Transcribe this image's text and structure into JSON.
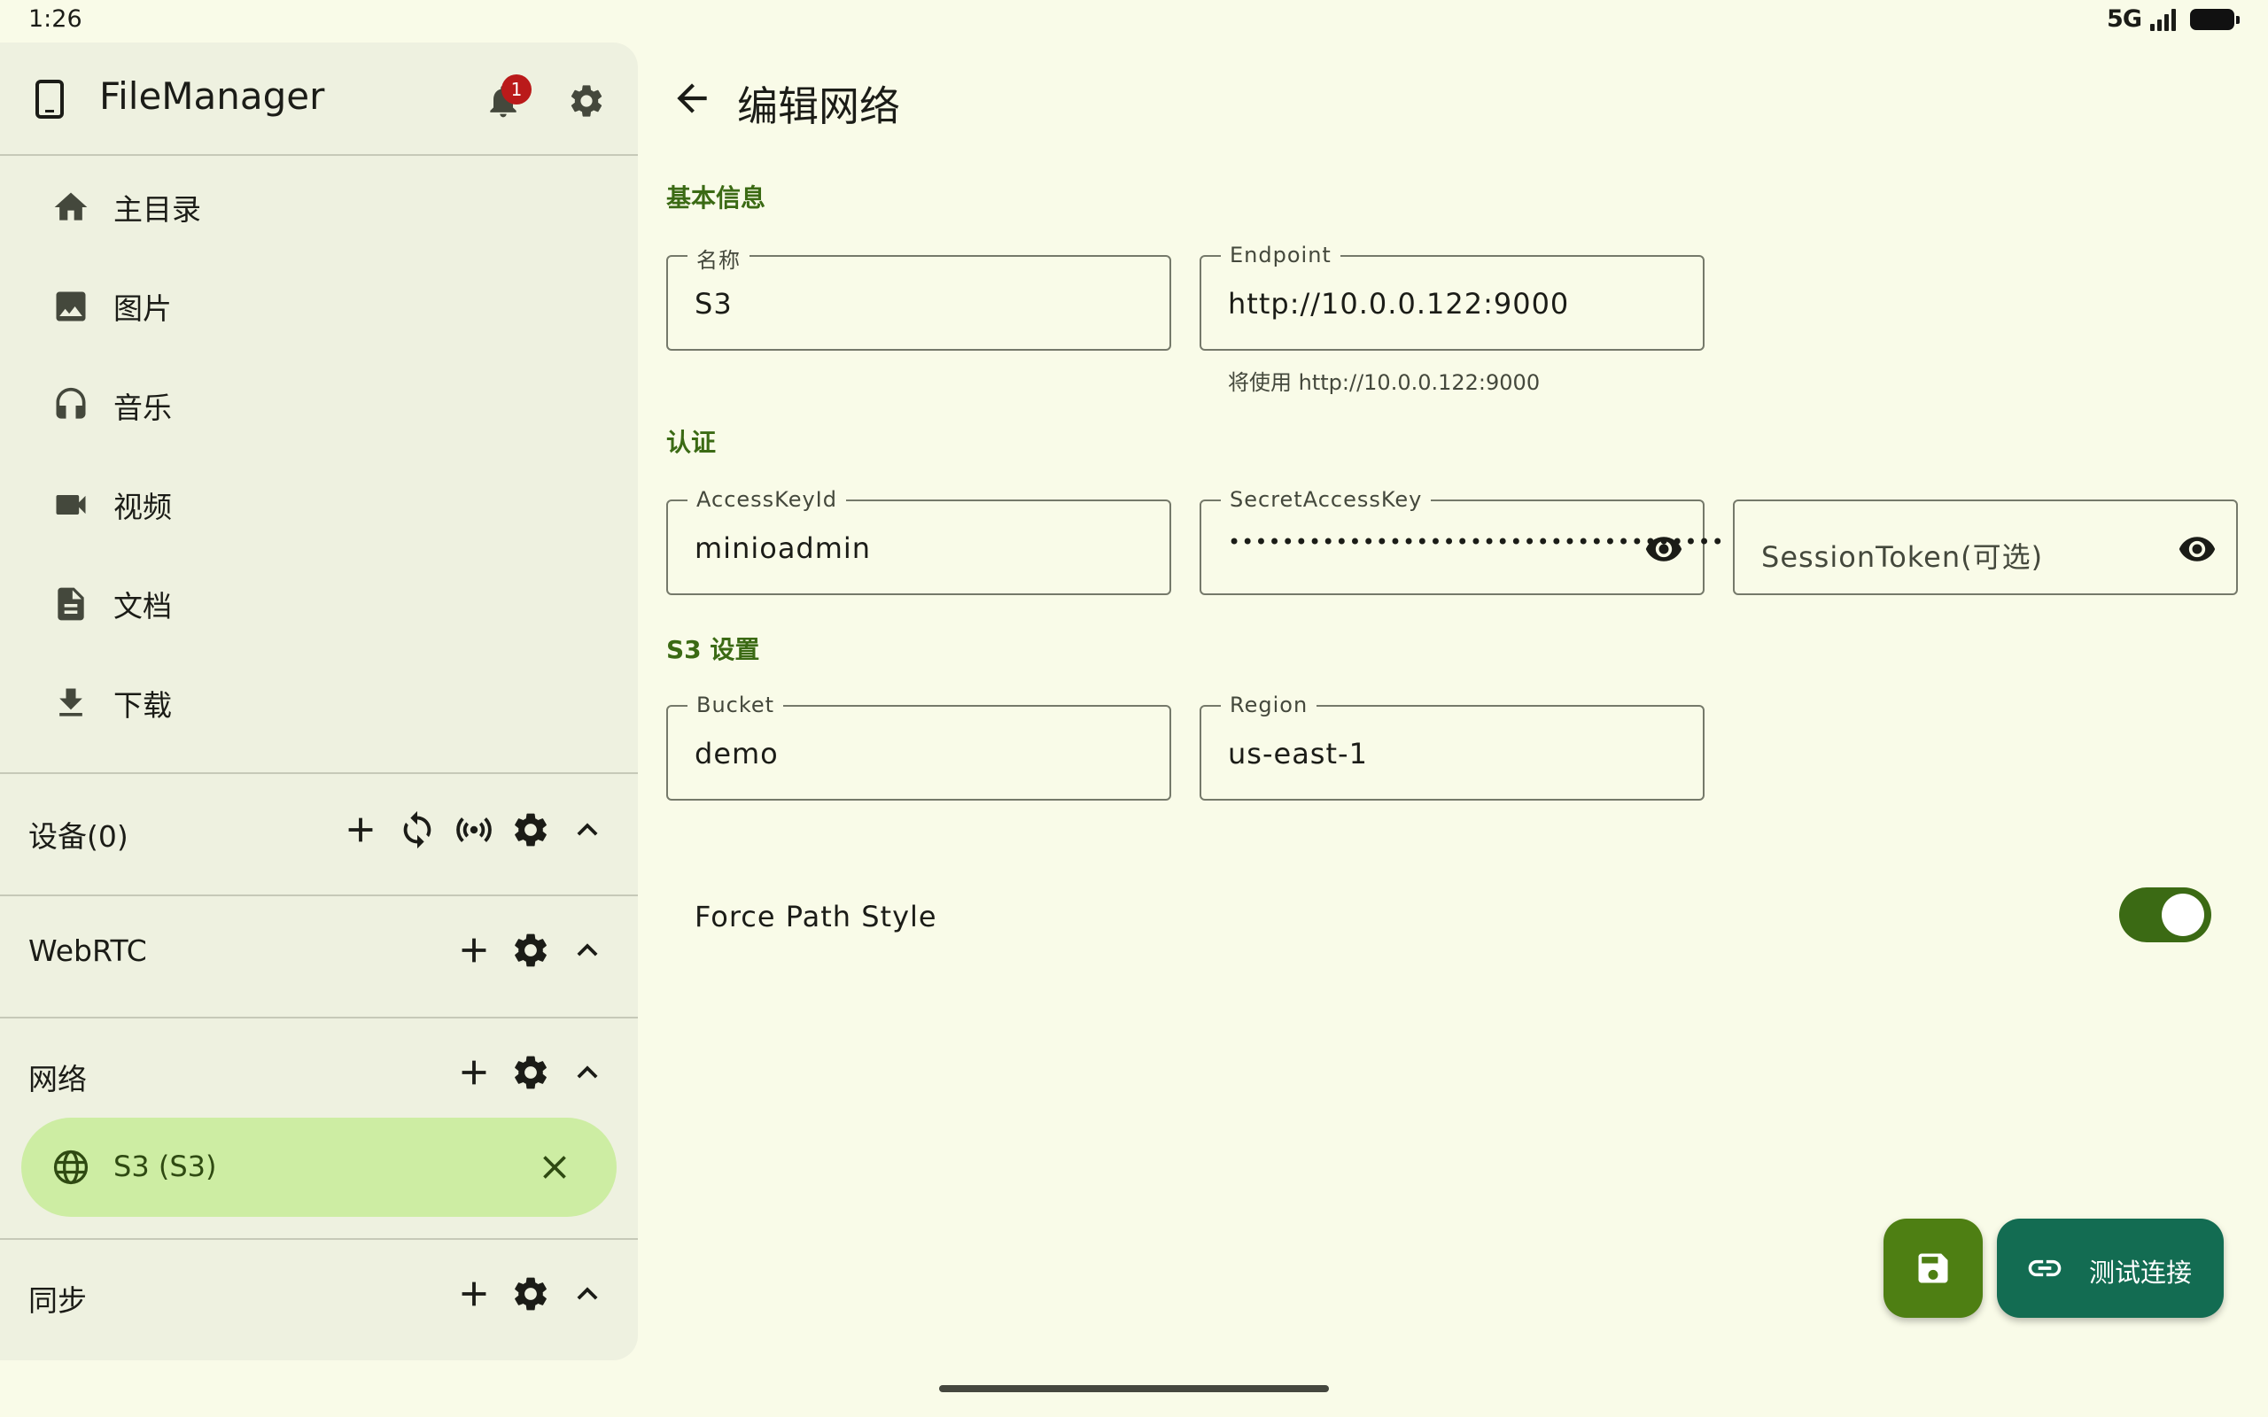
{
  "status_bar": {
    "time": "1:26",
    "network": "5G"
  },
  "drawer": {
    "app_title": "FileManager",
    "notification_count": "1",
    "nav_items": [
      {
        "label": "主目录",
        "icon": "home-icon"
      },
      {
        "label": "图片",
        "icon": "image-icon"
      },
      {
        "label": "音乐",
        "icon": "headphones-icon"
      },
      {
        "label": "视频",
        "icon": "videocam-icon"
      },
      {
        "label": "文档",
        "icon": "document-icon"
      },
      {
        "label": "下载",
        "icon": "download-icon"
      }
    ],
    "sections": {
      "devices": {
        "label": "设备(0)"
      },
      "webrtc": {
        "label": "WebRTC"
      },
      "network": {
        "label": "网络"
      },
      "sync": {
        "label": "同步"
      }
    },
    "network_item": {
      "label": "S3 (S3)"
    }
  },
  "main": {
    "title": "编辑网络",
    "sections": {
      "basic": "基本信息",
      "auth": "认证",
      "s3": "S3 设置"
    },
    "fields": {
      "name": {
        "label": "名称",
        "value": "S3"
      },
      "endpoint": {
        "label": "Endpoint",
        "value": "http://10.0.0.122:9000",
        "helper": "将使用 http://10.0.0.122:9000"
      },
      "access_key": {
        "label": "AccessKeyId",
        "value": "minioadmin"
      },
      "secret_key": {
        "label": "SecretAccessKey",
        "value": "•••••••••••••••••••••••••••••••••••••"
      },
      "session_token": {
        "placeholder": "SessionToken(可选)"
      },
      "bucket": {
        "label": "Bucket",
        "value": "demo"
      },
      "region": {
        "label": "Region",
        "value": "us-east-1"
      }
    },
    "force_path_style": {
      "label": "Force Path Style",
      "enabled": true
    },
    "test_button": {
      "label": "测试连接"
    }
  },
  "colors": {
    "primary": "#3b6a14",
    "save_fab": "#4e7f13",
    "test_fab": "#136c52",
    "selected_item": "#cdeda3",
    "badge": "#ba1a1a"
  }
}
